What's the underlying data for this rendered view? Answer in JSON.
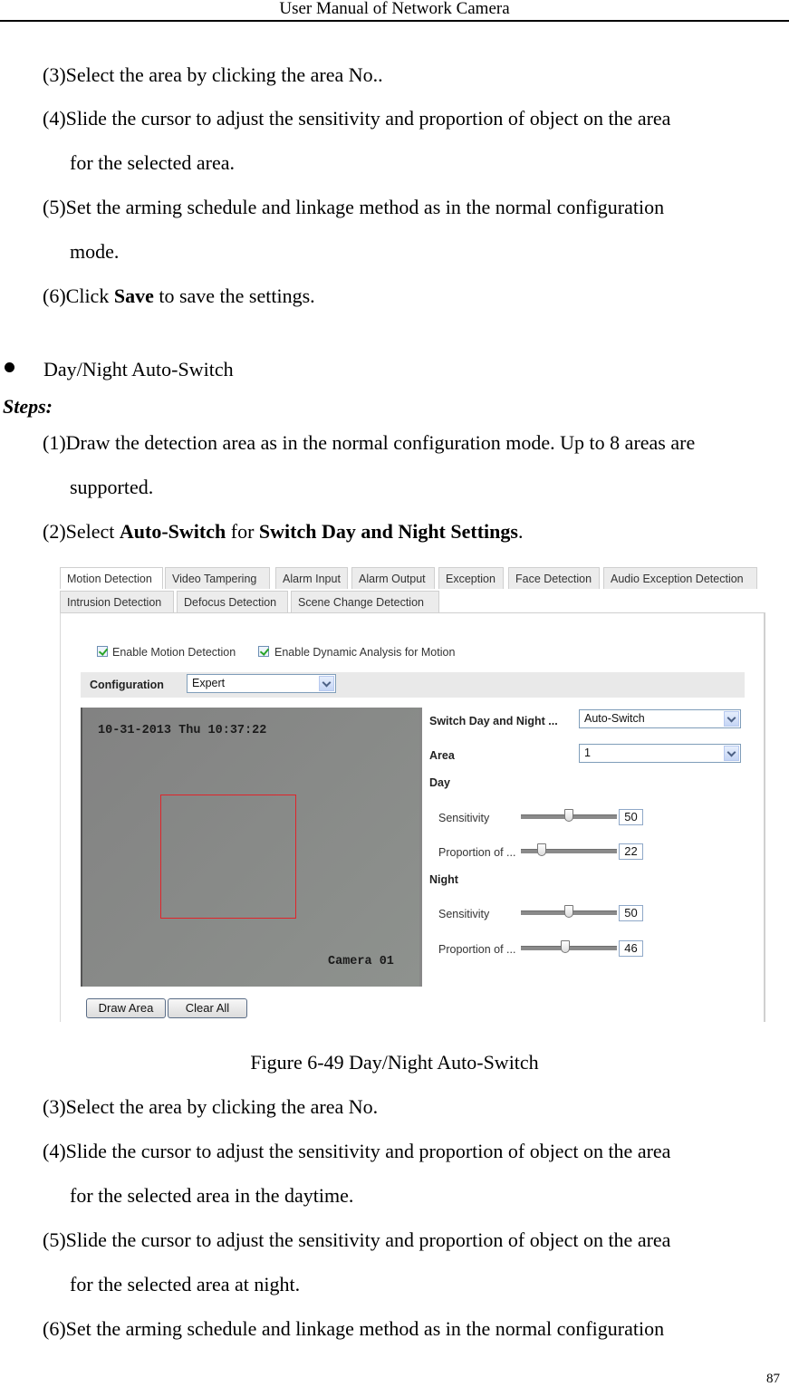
{
  "header": {
    "title": "User Manual of Network Camera",
    "page_number": "87"
  },
  "intro_steps": [
    {
      "text": "(3)Select the area by clicking the area No.."
    },
    {
      "text": "(4)Slide the cursor to adjust the sensitivity and proportion of object on the area",
      "cont": "for the selected area."
    },
    {
      "text": "(5)Set the arming schedule and linkage method as in the normal configuration",
      "cont": "mode."
    },
    {
      "pre": "(6)Click ",
      "bold": "Save",
      "post": " to save the settings."
    }
  ],
  "section": {
    "bullet_title": "Day/Night Auto-Switch",
    "steps_label": "Steps:"
  },
  "steps_before": {
    "s1": "(1)Draw the detection area as in the normal configuration mode. Up to 8 areas are",
    "s1_cont": "supported.",
    "s2_pre": "(2)Select ",
    "s2_bold1": "Auto-Switch",
    "s2_mid": " for ",
    "s2_bold2": "Switch Day and Night Settings",
    "s2_post": "."
  },
  "figure": {
    "tabs_row1": [
      "Motion Detection",
      "Video Tampering",
      "Alarm Input",
      "Alarm Output",
      "Exception",
      "Face Detection",
      "Audio Exception Detection"
    ],
    "tabs_row2": [
      "Intrusion Detection",
      "Defocus Detection",
      "Scene Change Detection"
    ],
    "active_tab": "Motion Detection",
    "checkboxes": [
      {
        "label": "Enable Motion Detection",
        "checked": true
      },
      {
        "label": "Enable Dynamic Analysis for Motion",
        "checked": true
      }
    ],
    "configuration": {
      "label": "Configuration",
      "value": "Expert"
    },
    "video": {
      "timestamp": "10-31-2013 Thu 10:37:22",
      "camera_name": "Camera 01",
      "roi_color": "#e0242a"
    },
    "switch_day_night": {
      "label": "Switch Day and Night ...",
      "value": "Auto-Switch"
    },
    "area": {
      "label": "Area",
      "value": "1"
    },
    "day": {
      "label": "Day",
      "sensitivity": {
        "label": "Sensitivity",
        "value": 50
      },
      "proportion": {
        "label": "Proportion of ...",
        "value": 22
      }
    },
    "night": {
      "label": "Night",
      "sensitivity": {
        "label": "Sensitivity",
        "value": 50
      },
      "proportion": {
        "label": "Proportion of ...",
        "value": 46
      }
    },
    "buttons": {
      "draw_area": "Draw Area",
      "clear_all": "Clear All"
    },
    "caption": "Figure 6-49 Day/Night Auto-Switch"
  },
  "steps_after": [
    {
      "text": "(3)Select the area by clicking the area No."
    },
    {
      "text": "(4)Slide the cursor to adjust the sensitivity and proportion of object on the area",
      "cont": "for the selected area in the daytime."
    },
    {
      "text": "(5)Slide the cursor to adjust the sensitivity and proportion of object on the area",
      "cont": "for the selected area at night."
    },
    {
      "text": "(6)Set the arming schedule and linkage method as in the normal configuration"
    }
  ]
}
